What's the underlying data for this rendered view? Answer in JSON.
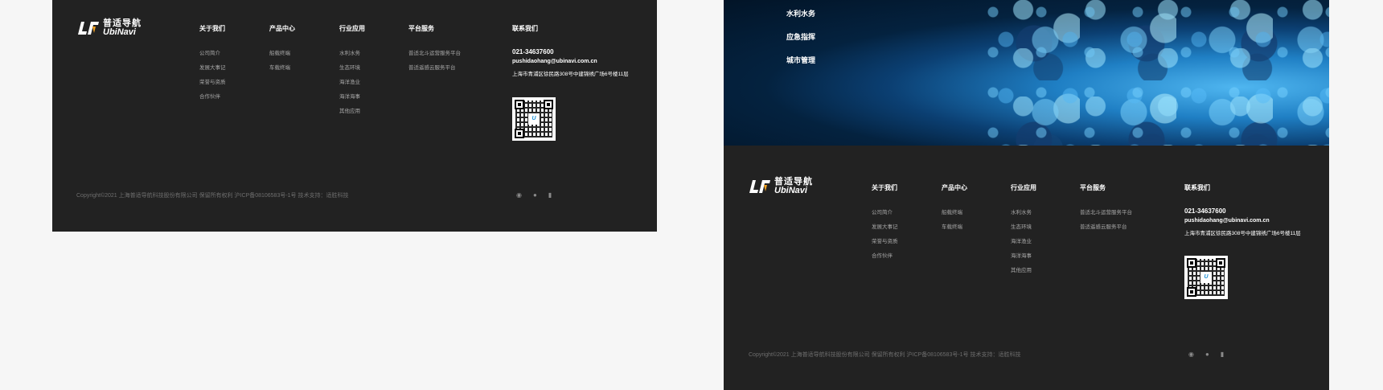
{
  "hero_menu": [
    "水利水务",
    "应急指挥",
    "城市管理"
  ],
  "logo": {
    "cn": "普适导航",
    "en": "UbiNavi"
  },
  "columns": [
    {
      "title": "关于我们",
      "items": [
        "公司简介",
        "发展大事记",
        "荣誉与资质",
        "合作伙伴"
      ]
    },
    {
      "title": "产品中心",
      "items": [
        "船载终端",
        "车载终端"
      ]
    },
    {
      "title": "行业应用",
      "items": [
        "水利水务",
        "生态环境",
        "海洋渔业",
        "海洋海事",
        "其他应用"
      ]
    },
    {
      "title": "平台服务",
      "items": [
        "普适北斗运营服务平台",
        "普适遥感云服务平台"
      ]
    }
  ],
  "contact": {
    "title": "联系我们",
    "phone": "021-34637600",
    "email": "pushidaohang@ubinavi.com.cn",
    "address": "上海市青浦区徐民路308号中建锦绣广场6号楼11层"
  },
  "copyright": "Copyright©2021 上海普适导航科技股份有限公司 保留所有权利  沪ICP备08106583号-1号 技术支持：适胜科技",
  "social_icons": [
    "weibo-icon",
    "wechat-icon",
    "lock-icon"
  ],
  "colors": {
    "background": "#222222",
    "page": "#f6f6f6",
    "accent": "#1a8fd6"
  }
}
